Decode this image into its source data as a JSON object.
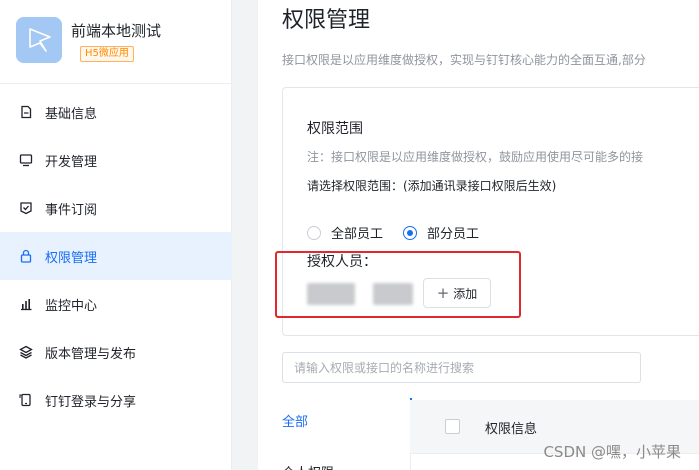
{
  "app": {
    "name": "前端本地测试",
    "tag": "H5微应用"
  },
  "sidebar": {
    "items": [
      {
        "label": "基础信息",
        "icon": "document-icon",
        "active": false
      },
      {
        "label": "开发管理",
        "icon": "monitor-icon",
        "active": false
      },
      {
        "label": "事件订阅",
        "icon": "subscribe-icon",
        "active": false
      },
      {
        "label": "权限管理",
        "icon": "lock-icon",
        "active": true
      },
      {
        "label": "监控中心",
        "icon": "bar-chart-icon",
        "active": false
      },
      {
        "label": "版本管理与发布",
        "icon": "layers-icon",
        "active": false
      },
      {
        "label": "钉钉登录与分享",
        "icon": "phone-share-icon",
        "active": false
      }
    ]
  },
  "main": {
    "title": "权限管理",
    "description": "接口权限是以应用维度做授权，实现与钉钉核心能力的全面互通,部分",
    "scope": {
      "title": "权限范围",
      "note": "注：接口权限是以应用维度做授权，鼓励应用使用尽可能多的接",
      "select_prompt": "请选择权限范围：(添加通讯录接口权限后生效)",
      "options": [
        {
          "label": "全部员工",
          "checked": false
        },
        {
          "label": "部分员工",
          "checked": true
        }
      ],
      "authorized_label": "授权人员：",
      "add_button": "添加"
    },
    "search": {
      "placeholder": "请输入权限或接口的名称进行搜索"
    },
    "categories": {
      "all": "全部",
      "next_partial": "个人权限"
    },
    "table": {
      "header": "权限信息"
    }
  },
  "watermark": "CSDN @嘿，小苹果",
  "colors": {
    "accent": "#1a6ef5",
    "highlight": "#e2282f",
    "tag": "#ff8a00"
  }
}
